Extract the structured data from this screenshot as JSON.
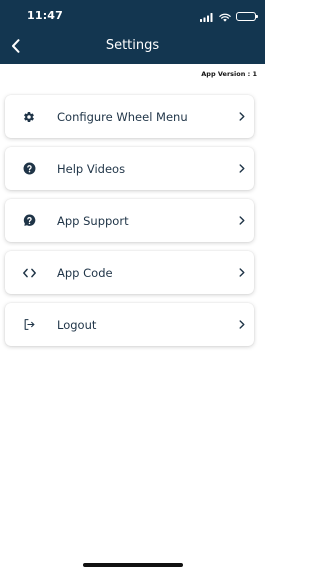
{
  "status_bar": {
    "time": "11:47"
  },
  "header": {
    "title": "Settings"
  },
  "app_version_label": "App Version : 1",
  "menu": {
    "items": [
      {
        "label": "Configure Wheel Menu",
        "icon": "gear-icon"
      },
      {
        "label": "Help Videos",
        "icon": "question-circle-icon"
      },
      {
        "label": "App Support",
        "icon": "question-chat-icon"
      },
      {
        "label": "App Code",
        "icon": "code-icon"
      },
      {
        "label": "Logout",
        "icon": "logout-icon"
      }
    ]
  },
  "colors": {
    "header_bg": "#133650",
    "text": "#1f3447",
    "background": "#ffffff"
  }
}
